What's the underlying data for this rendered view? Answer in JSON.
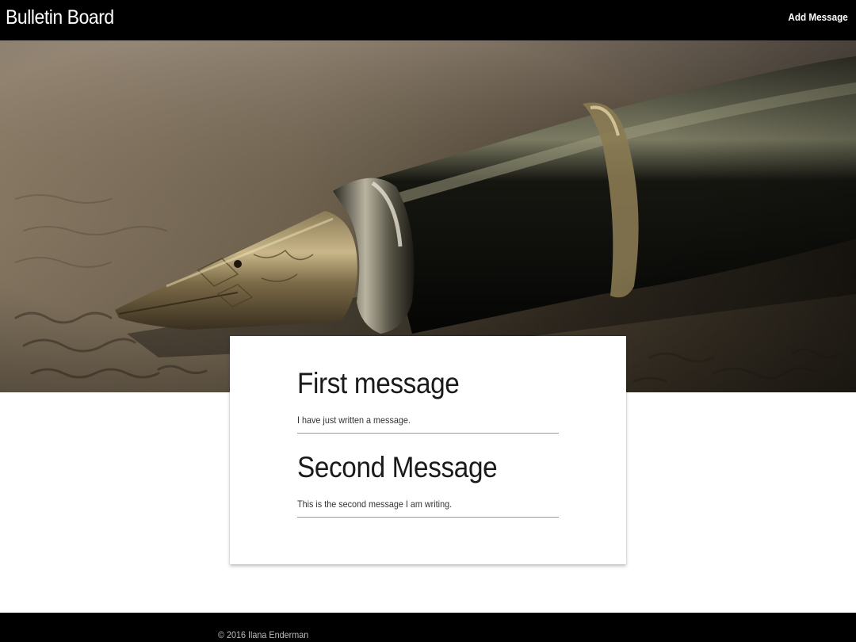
{
  "header": {
    "brand": "Bulletin Board",
    "add_message_label": "Add Message"
  },
  "hero": {
    "image_description_icon": "fountain-pen-image"
  },
  "messages": [
    {
      "title": "First message",
      "body": "I have just written a message."
    },
    {
      "title": "Second Message",
      "body": "This is the second message I am writing."
    }
  ],
  "footer": {
    "copyright": "© 2016 Ilana Enderman"
  },
  "colors": {
    "navbar": "#000000",
    "card": "#ffffff",
    "divider": "#9a9a9a",
    "text_dark": "#1a1a1a"
  }
}
